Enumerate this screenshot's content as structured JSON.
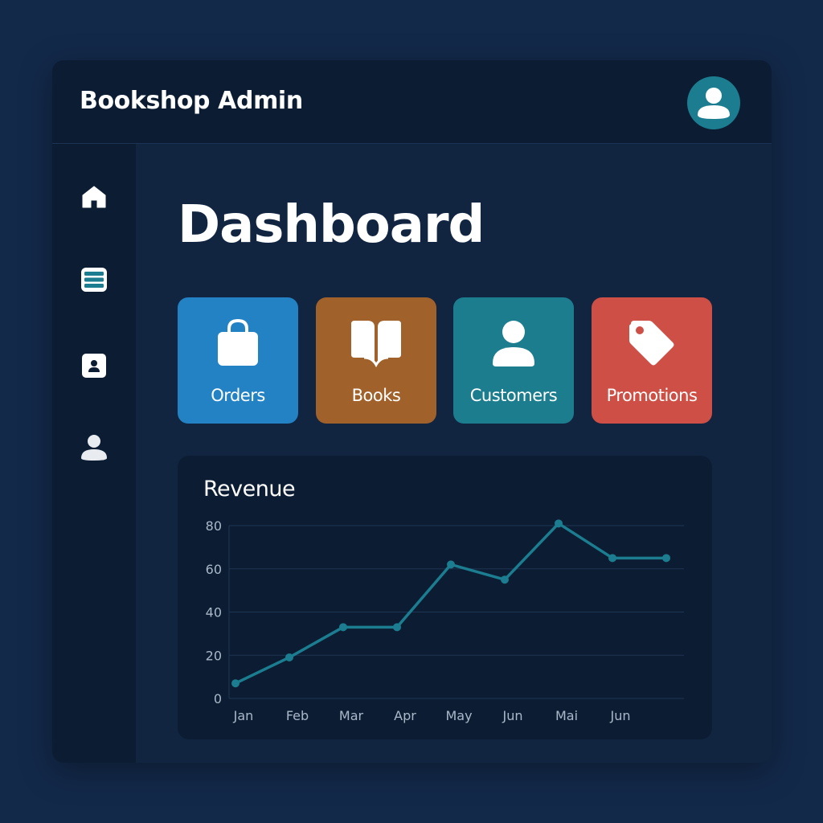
{
  "header": {
    "title": "Bookshop Admin",
    "avatar_icon": "user-avatar-icon"
  },
  "sidebar": {
    "items": [
      {
        "icon": "home-icon"
      },
      {
        "icon": "list-icon"
      },
      {
        "icon": "contact-card-icon"
      },
      {
        "icon": "user-icon"
      }
    ]
  },
  "main": {
    "title": "Dashboard",
    "tiles": [
      {
        "label": "Orders",
        "icon": "shopping-bag-icon",
        "color": "#2382c4"
      },
      {
        "label": "Books",
        "icon": "open-book-icon",
        "color": "#a0612b"
      },
      {
        "label": "Customers",
        "icon": "user-icon",
        "color": "#1c7d8e"
      },
      {
        "label": "Promotions",
        "icon": "tag-icon",
        "color": "#cd4f45"
      }
    ]
  },
  "chart": {
    "title": "Revenue"
  },
  "chart_data": {
    "type": "line",
    "title": "Revenue",
    "categories": [
      "Jan",
      "Feb",
      "Mar",
      "Apr",
      "May",
      "Jun",
      "Mai",
      "Jun"
    ],
    "values": [
      7,
      19,
      33,
      33,
      62,
      55,
      81,
      65,
      65
    ],
    "yticks": [
      0,
      20,
      40,
      60,
      80
    ],
    "ylim": [
      0,
      80
    ],
    "grid": true,
    "line_color": "#1b7d8f"
  }
}
